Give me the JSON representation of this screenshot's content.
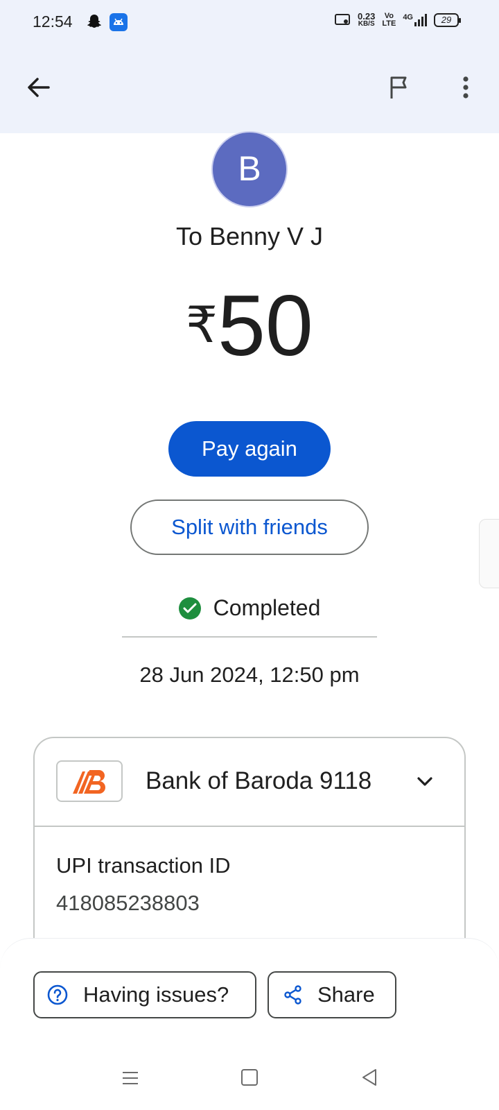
{
  "status_bar": {
    "time": "12:54",
    "net_speed_value": "0.23",
    "net_speed_unit": "KB/S",
    "volte_top": "Vo",
    "volte_bottom": "LTE",
    "network": "4G",
    "battery": "29",
    "icons": [
      "snapchat-icon",
      "android-app-icon",
      "cast-icon",
      "signal-icon",
      "battery-icon"
    ]
  },
  "app_bar": {
    "icons": [
      "back-arrow-icon",
      "flag-icon",
      "more-vert-icon"
    ]
  },
  "recipient": {
    "avatar_letter": "B",
    "avatar_color": "#5c6bc0",
    "to_label": "To Benny V J"
  },
  "payment": {
    "currency_symbol": "₹",
    "amount": "50"
  },
  "actions": {
    "pay_again": "Pay again",
    "split": "Split with friends"
  },
  "status": {
    "label": "Completed",
    "color": "#1e8e3e",
    "datetime": "28 Jun 2024, 12:50 pm"
  },
  "details": {
    "bank_name": "Bank of Baroda 9118",
    "upi_label": "UPI transaction ID",
    "upi_id": "418085238803"
  },
  "bottom": {
    "issues": "Having issues?",
    "share": "Share"
  },
  "colors": {
    "primary": "#0b57d0",
    "header_bg": "#eef2fb",
    "bank_orange": "#f26522"
  },
  "nav_bar": {
    "icons": [
      "recents-icon",
      "home-icon",
      "back-icon"
    ]
  }
}
